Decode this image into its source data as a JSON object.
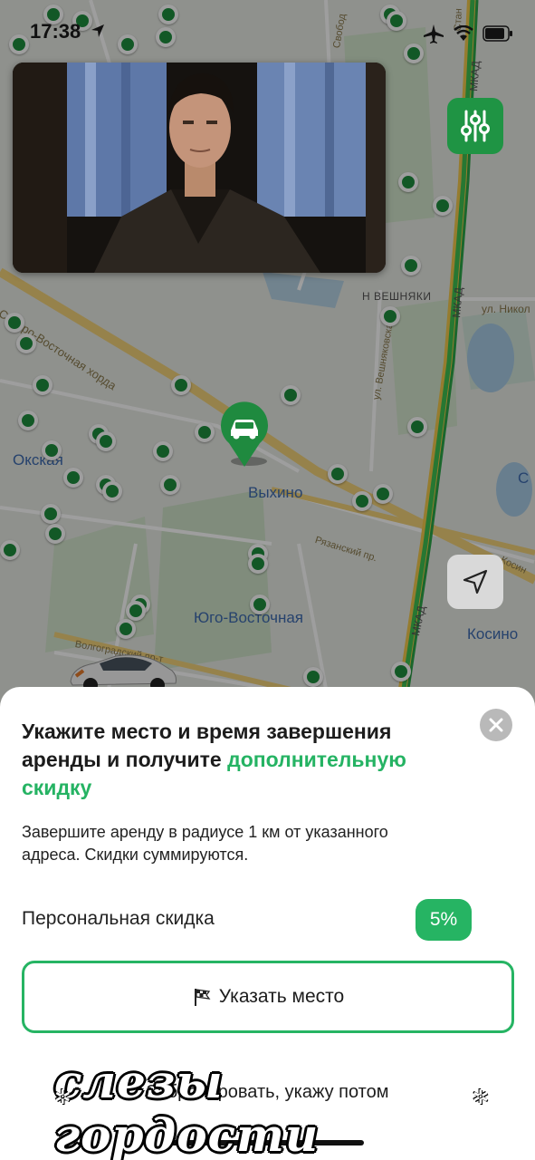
{
  "status_bar": {
    "time": "17:38"
  },
  "map": {
    "labels": {
      "okskaya": "Окская",
      "vykhino": "Выхино",
      "yugo_vostochnaya": "Юго-Восточная",
      "kosino": "Косино",
      "n_veshnyaki": "Н ВЕШНЯКИ",
      "mkad_1": "МКАД",
      "mkad_2": "МКАД",
      "mkad_3": "МКАД",
      "severo_vostochnaya": "Северо-Восточная хорда",
      "ryazansky": "Рязанский пр.",
      "volgogradsky": "Волгоградский пр-т",
      "ul_veshnyakovskaya": "ул. Вешняковская",
      "ul_nikol": "ул. Никол",
      "svobodny": "Свобод",
      "kosin": "Косин",
      "stan": "Стан",
      "s_edge": "С"
    }
  },
  "sheet": {
    "title_part1": "Укажите место и время завершения аренды и получите ",
    "title_accent": "дополнительную скидку",
    "description": "Завершите аренду в радиусе 1 км от указанного адреса. Скидки суммируются.",
    "discount_label": "Персональная скидка",
    "discount_value": "5%",
    "place_button": "Указать место",
    "later_link": "Забронировать, укажу потом"
  },
  "watermark": {
    "text": "слезы гордости"
  },
  "colors": {
    "accent": "#26b463",
    "brand_green": "#1f9444"
  }
}
